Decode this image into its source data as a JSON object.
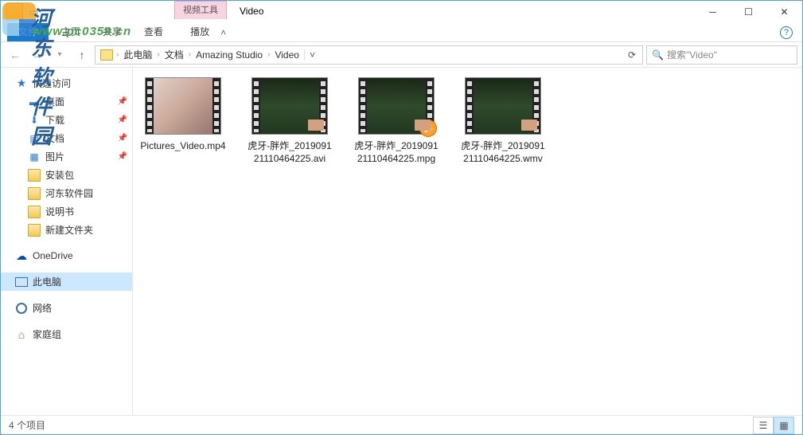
{
  "window": {
    "tool_context_label": "视频工具",
    "title": "Video"
  },
  "ribbon": {
    "file": "文件",
    "tabs": [
      "主页",
      "共享",
      "查看"
    ],
    "context_tab": "播放"
  },
  "nav": {
    "breadcrumb": [
      "此电脑",
      "文档",
      "Amazing Studio",
      "Video"
    ],
    "search_placeholder": "搜索\"Video\""
  },
  "sidebar": {
    "quick_access": "快速访问",
    "pinned": [
      {
        "label": "桌面",
        "type": "desktop"
      },
      {
        "label": "下载",
        "type": "downloads"
      },
      {
        "label": "文档",
        "type": "documents"
      },
      {
        "label": "图片",
        "type": "pictures"
      }
    ],
    "folders": [
      "安装包",
      "河东软件园",
      "说明书",
      "新建文件夹"
    ],
    "onedrive": "OneDrive",
    "thispc": "此电脑",
    "network": "网络",
    "homegroup": "家庭组"
  },
  "files": [
    {
      "name": "Pictures_Video.mp4",
      "thumb": "photo",
      "play": false
    },
    {
      "name": "虎牙-胖炸_20190912111046​4225.avi",
      "thumb": "game",
      "play": false
    },
    {
      "name": "虎牙-胖炸_20190912111046​4225.mpg",
      "thumb": "game",
      "play": true
    },
    {
      "name": "虎牙-胖炸_20190912111046​4225.wmv",
      "thumb": "game",
      "play": false
    }
  ],
  "status": {
    "count_label": "4 个项目"
  },
  "watermark": {
    "line1": "河东软件园",
    "line2": "www.pc0359.cn"
  }
}
